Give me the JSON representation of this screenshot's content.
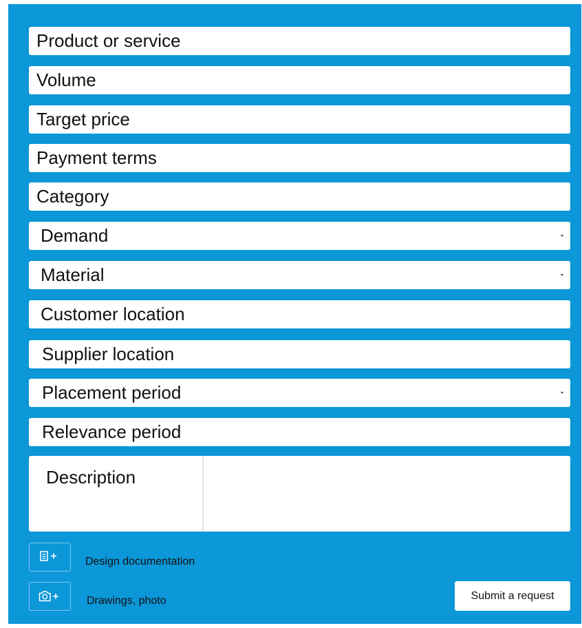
{
  "form": {
    "fields": [
      {
        "label": "Product or service",
        "type": "text"
      },
      {
        "label": "Volume",
        "type": "text"
      },
      {
        "label": "Target price",
        "type": "text"
      },
      {
        "label": "Payment terms",
        "type": "text"
      },
      {
        "label": "Category",
        "type": "text"
      },
      {
        "label": "Demand",
        "type": "select"
      },
      {
        "label": "Material",
        "type": "select"
      },
      {
        "label": "Customer location",
        "type": "text"
      },
      {
        "label": "Supplier location",
        "type": "text"
      },
      {
        "label": "Placement period",
        "type": "select"
      },
      {
        "label": "Relevance period",
        "type": "text"
      }
    ],
    "description_label": "Description",
    "attachments": {
      "design_doc_label": "Design documentation",
      "drawings_label": "Drawings, photo",
      "design_doc_icon": "document-plus-icon",
      "drawings_icon": "camera-plus-icon"
    },
    "submit_label": "Submit a request"
  },
  "colors": {
    "panel": "#0b97d8",
    "field": "#ffffff",
    "text": "#111111"
  }
}
